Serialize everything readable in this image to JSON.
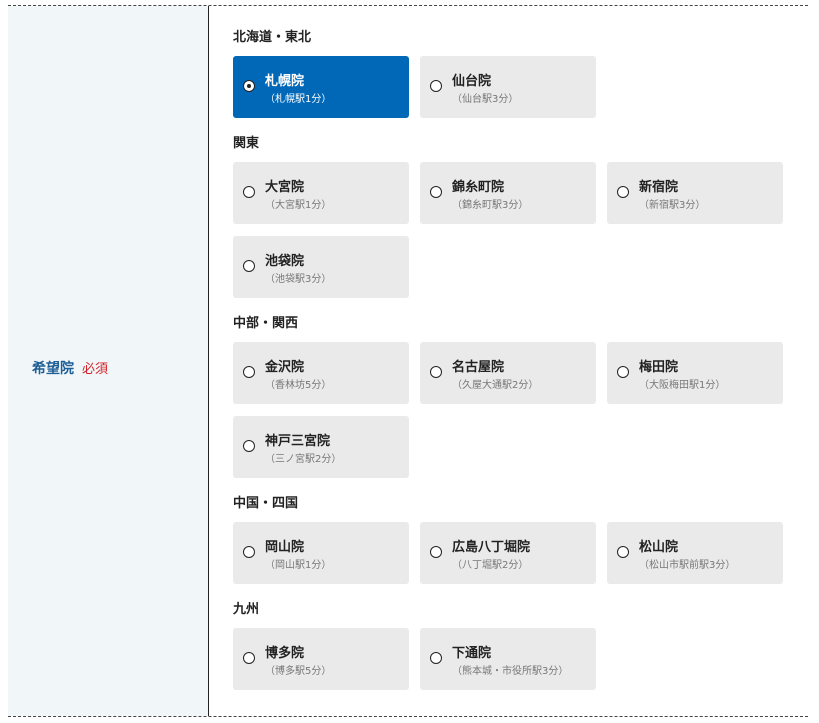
{
  "field": {
    "label": "希望院",
    "required": "必須"
  },
  "regions": [
    {
      "title": "北海道・東北",
      "clinics": [
        {
          "name": "札幌院",
          "access": "（札幌駅1分）",
          "selected": true
        },
        {
          "name": "仙台院",
          "access": "（仙台駅3分）",
          "selected": false
        }
      ]
    },
    {
      "title": "関東",
      "clinics": [
        {
          "name": "大宮院",
          "access": "（大宮駅1分）",
          "selected": false
        },
        {
          "name": "錦糸町院",
          "access": "（錦糸町駅3分）",
          "selected": false
        },
        {
          "name": "新宿院",
          "access": "（新宿駅3分）",
          "selected": false
        },
        {
          "name": "池袋院",
          "access": "（池袋駅3分）",
          "selected": false
        }
      ]
    },
    {
      "title": "中部・関西",
      "clinics": [
        {
          "name": "金沢院",
          "access": "（香林坊5分）",
          "selected": false
        },
        {
          "name": "名古屋院",
          "access": "（久屋大通駅2分）",
          "selected": false
        },
        {
          "name": "梅田院",
          "access": "（大阪梅田駅1分）",
          "selected": false
        },
        {
          "name": "神戸三宮院",
          "access": "（三ノ宮駅2分）",
          "selected": false
        }
      ]
    },
    {
      "title": "中国・四国",
      "clinics": [
        {
          "name": "岡山院",
          "access": "（岡山駅1分）",
          "selected": false
        },
        {
          "name": "広島八丁堀院",
          "access": "（八丁堀駅2分）",
          "selected": false
        },
        {
          "name": "松山院",
          "access": "（松山市駅前駅3分）",
          "selected": false
        }
      ]
    },
    {
      "title": "九州",
      "clinics": [
        {
          "name": "博多院",
          "access": "（博多駅5分）",
          "selected": false
        },
        {
          "name": "下通院",
          "access": "（熊本城・市役所駅3分）",
          "selected": false
        }
      ]
    }
  ]
}
